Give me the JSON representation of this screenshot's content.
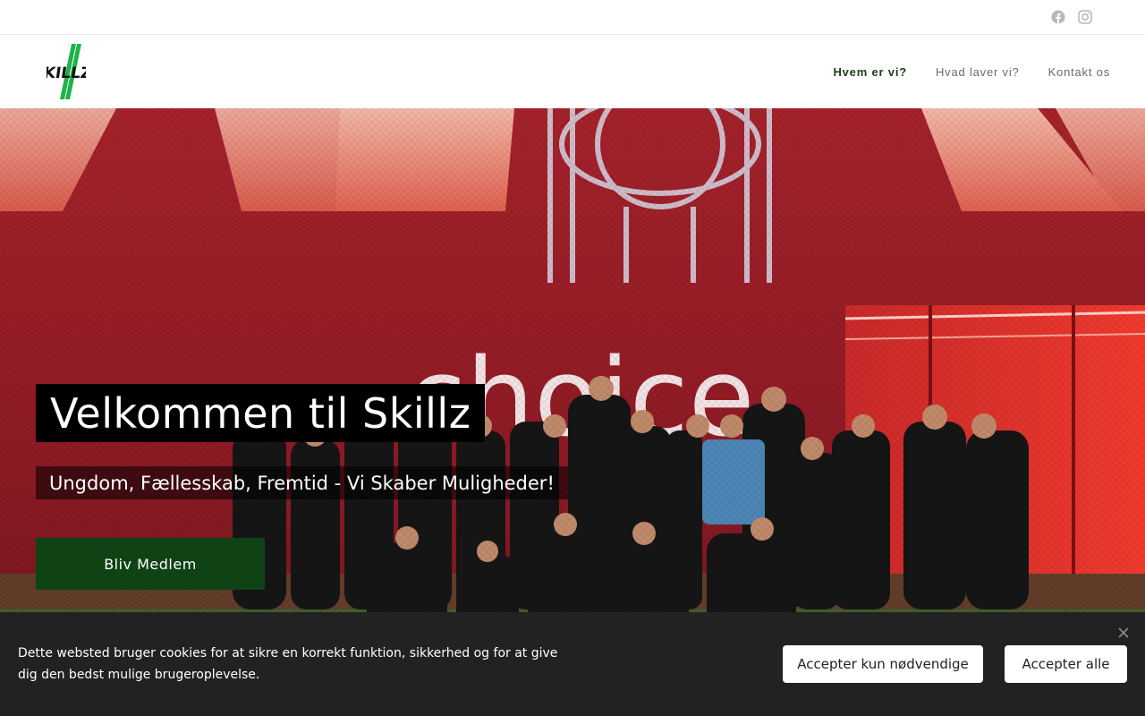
{
  "topbar": {
    "social": [
      {
        "icon": "facebook-icon"
      },
      {
        "icon": "instagram-icon"
      }
    ]
  },
  "header": {
    "logo_text": "SKILLZ",
    "nav": [
      {
        "label": "Hvem er vi?",
        "active": true
      },
      {
        "label": "Hvad laver vi?",
        "active": false
      },
      {
        "label": "Kontakt os",
        "active": false
      }
    ]
  },
  "hero": {
    "title": "Velkommen til Skillz",
    "subtitle": "Ungdom, Fællesskab, Fremtid - Vi Skaber Muligheder!",
    "cta_label": "Bliv Medlem",
    "background_text": "choice"
  },
  "cookie": {
    "text": "Dette websted bruger cookies for at sikre en korrekt funktion, sikkerhed og for at give dig den bedst mulige brugeroplevelse.",
    "accept_necessary_label": "Accepter kun nødvendige",
    "accept_all_label": "Accepter alle",
    "close_icon": "close-icon"
  },
  "colors": {
    "accent_green": "#0f4214",
    "nav_active": "#1f3d1a",
    "banner_bg": "#222222"
  }
}
